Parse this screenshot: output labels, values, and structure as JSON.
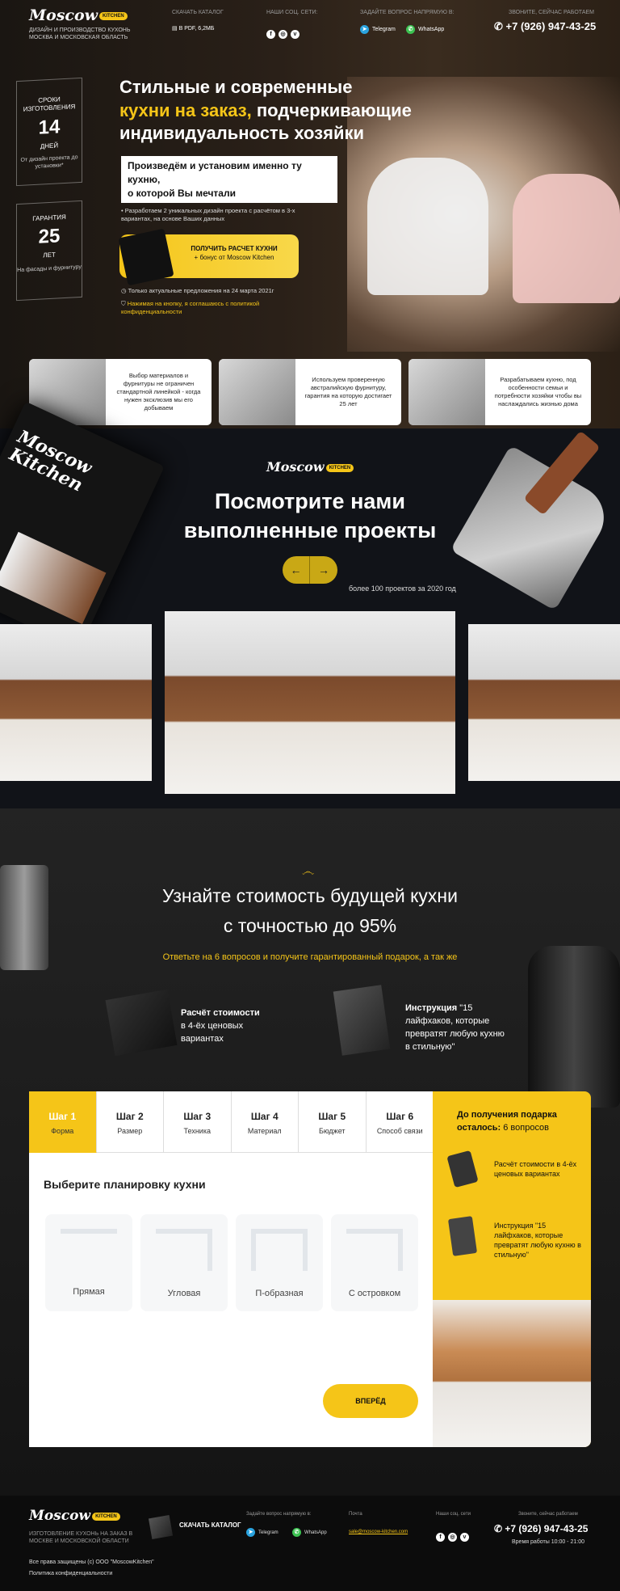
{
  "header": {
    "logo": "Moscow",
    "logo_badge": "KITCHEN",
    "tagline": "ДИЗАЙН И ПРОИЗВОДСТВО КУХОНЬ МОСКВА И МОСКОВСКАЯ ОБЛАСТЬ",
    "catalog_label": "СКАЧАТЬ КАТАЛОГ",
    "catalog_file": "В PDF, 6,2МБ",
    "social_label": "НАШИ СОЦ. СЕТИ:",
    "ask_label": "ЗАДАЙТЕ ВОПРОС НАПРЯМУЮ В:",
    "telegram": "Telegram",
    "whatsapp": "WhatsApp",
    "call_label": "ЗВОНИТЕ, СЕЙЧАС РАБОТАЕМ",
    "phone": "+7 (926) 947-43-25"
  },
  "hero": {
    "stat1": {
      "label": "СРОКИ ИЗГОТОВЛЕНИЯ",
      "number": "14",
      "unit": "ДНЕЙ",
      "note": "От дизайн проекта до установки*"
    },
    "stat2": {
      "label": "ГАРАНТИЯ",
      "number": "25",
      "unit": "ЛЕТ",
      "note": "На фасады и фурнитуру"
    },
    "title_1": "Стильные и современные",
    "title_accent": "кухни на заказ,",
    "title_2": "подчеркивающие",
    "title_3": "индивидуальность хозяйки",
    "box_1": "Произведём и установим именно ту кухню,",
    "box_2": "о которой Вы мечтали",
    "bullet": "Разработаем 2 уникальных дизайн проекта с расчётом в 3-х вариантах, на основе Ваших данных",
    "cta_1": "ПОЛУЧИТЬ РАСЧЕТ КУХНИ",
    "cta_2": "+ бонус от Moscow Kitchen",
    "note_date": "Только актуальные предложения на 24 марта 2021г",
    "note_policy": "Нажимая на кнопку, я соглашаюсь с политикой конфиденциальности"
  },
  "features": [
    {
      "text": "Выбор материалов и фурнитуры не ограничен стандартной линейкой - когда нужен эксклюзив мы его добываем"
    },
    {
      "text": "Используем проверенную австралийскую фурнитуру, гарантия на которую достигает 25 лет"
    },
    {
      "text": "Разрабатываем кухню, под особенности семьи и потребности хозяйки чтобы вы наслаждались жизнью дома"
    }
  ],
  "projects": {
    "title_1": "Посмотрите нами",
    "title_2": "выполненные проекты",
    "count": "более 100 проектов за 2020 год",
    "prev": "←",
    "next": "→",
    "book": "Moscow Kitchen"
  },
  "quiz_intro": {
    "title_1": "Узнайте стоимость будущей кухни",
    "title_2": "с точностью до 95%",
    "subtitle": "Ответьте на 6 вопросов и получите гарантированный подарок, а так же",
    "gift1_bold": "Расчёт стоимости",
    "gift1_rest": "в 4-ёх ценовых вариантах",
    "gift2_bold": "Инструкция",
    "gift2_rest": "\"15 лайфхаков, которые превратят любую кухню в стильную\""
  },
  "steps": [
    {
      "title": "Шаг 1",
      "label": "Форма"
    },
    {
      "title": "Шаг 2",
      "label": "Размер"
    },
    {
      "title": "Шаг 3",
      "label": "Техника"
    },
    {
      "title": "Шаг 4",
      "label": "Материал"
    },
    {
      "title": "Шаг 5",
      "label": "Бюджет"
    },
    {
      "title": "Шаг 6",
      "label": "Способ связи"
    }
  ],
  "quiz": {
    "question": "Выберите планировку кухни",
    "options": [
      {
        "label": "Прямая"
      },
      {
        "label": "Угловая"
      },
      {
        "label": "П-образная"
      },
      {
        "label": "С островком"
      }
    ],
    "next": "ВПЕРЁД"
  },
  "gift_panel": {
    "head_1": "До получения подарка",
    "head_2": "осталось:",
    "head_count": "6 вопросов",
    "item1": "Расчёт стоимости в 4-ёх ценовых вариантах",
    "item2": "Инструкция \"15 лайфхаков, которые превратят любую кухню в стильную\""
  },
  "footer": {
    "logo": "Moscow",
    "logo_badge": "KITCHEN",
    "tagline": "ИЗГОТОВЛЕНИЕ КУХОНЬ НА ЗАКАЗ В МОСКВЕ И МОСКОВСКОЙ ОБЛАСТИ",
    "catalog": "СКАЧАТЬ КАТАЛОГ",
    "ask_label": "Задайте вопрос напрямую в:",
    "telegram": "Telegram",
    "whatsapp": "WhatsApp",
    "mail_label": "Почта",
    "email": "sale@moscow-kitchen.com",
    "social_label": "Наши соц. сети",
    "call_label": "Звоните, сейчас работаем",
    "phone": "+7 (926) 947-43-25",
    "hours": "Время работы 10:00 - 21:00",
    "copyright": "Все права защищены (c) ООО \"MoscowKitchen\"",
    "policy": "Политика конфиденциальности"
  }
}
